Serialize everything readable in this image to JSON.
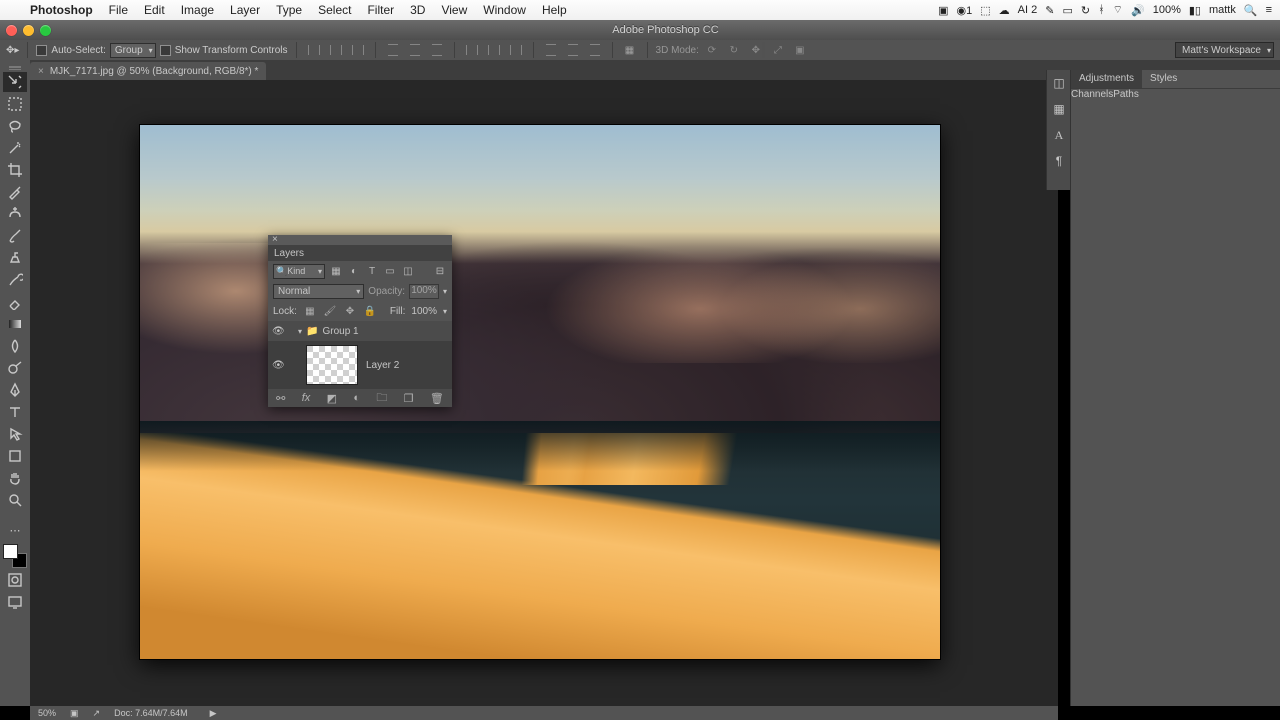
{
  "menubar": {
    "app": "Photoshop",
    "items": [
      "File",
      "Edit",
      "Image",
      "Layer",
      "Type",
      "Select",
      "Filter",
      "3D",
      "View",
      "Window",
      "Help"
    ],
    "status": {
      "battery": "100%",
      "user": "mattk",
      "ai_badge": "AI 2"
    }
  },
  "window": {
    "title": "Adobe Photoshop CC"
  },
  "options": {
    "auto_select": "Auto-Select:",
    "target": "Group",
    "show_transform": "Show Transform Controls",
    "mode3d": "3D Mode:",
    "workspace": "Matt's Workspace"
  },
  "document": {
    "tab": "MJK_7171.jpg @ 50% (Background, RGB/8*) *"
  },
  "rightpanel": {
    "tabs1": [
      "Adjustments",
      "Styles"
    ],
    "tabs2": [
      "Channels",
      "Paths"
    ]
  },
  "layers": {
    "title": "Layers",
    "kind": "Kind",
    "blend": "Normal",
    "opacity_label": "Opacity:",
    "opacity_value": "100%",
    "lock_label": "Lock:",
    "fill_label": "Fill:",
    "fill_value": "100%",
    "group_name": "Group 1",
    "layer_name": "Layer 2"
  },
  "status": {
    "zoom": "50%",
    "doc": "Doc: 7.64M/7.64M"
  },
  "colors": {
    "close": "#ff5f57",
    "min": "#febc2e",
    "max": "#28c840"
  }
}
